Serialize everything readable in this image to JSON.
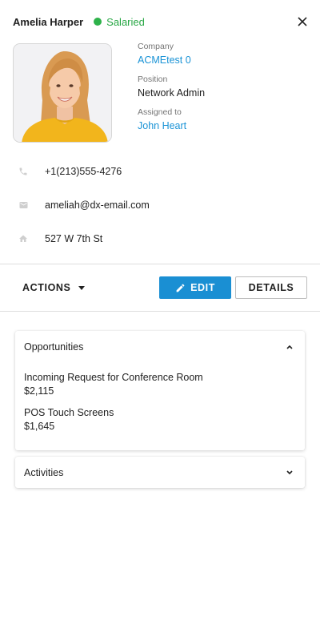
{
  "header": {
    "name": "Amelia Harper",
    "status": "Salaried",
    "status_color": "#2eb24a"
  },
  "profile": {
    "company_label": "Company",
    "company_value": "ACMEtest 0",
    "position_label": "Position",
    "position_value": "Network Admin",
    "assigned_label": "Assigned to",
    "assigned_value": "John Heart"
  },
  "contacts": {
    "phone": "+1(213)555-4276",
    "email": "ameliah@dx-email.com",
    "address": "527 W 7th St"
  },
  "toolbar": {
    "actions_label": "ACTIONS",
    "edit_label": "EDIT",
    "details_label": "DETAILS",
    "accent_color": "#1a8fd3"
  },
  "opportunities": {
    "title": "Opportunities",
    "items": [
      {
        "name": "Incoming Request for Conference Room",
        "amount": "$2,115"
      },
      {
        "name": "POS Touch Screens",
        "amount": "$1,645"
      }
    ]
  },
  "activities": {
    "title": "Activities"
  },
  "icons": {
    "close": "close-icon",
    "phone": "phone-icon",
    "email": "mail-icon",
    "address": "home-icon",
    "edit": "pencil-icon",
    "actions_caret": "caret-down-icon",
    "collapse": "chevron-up-icon",
    "expand": "chevron-down-icon"
  }
}
